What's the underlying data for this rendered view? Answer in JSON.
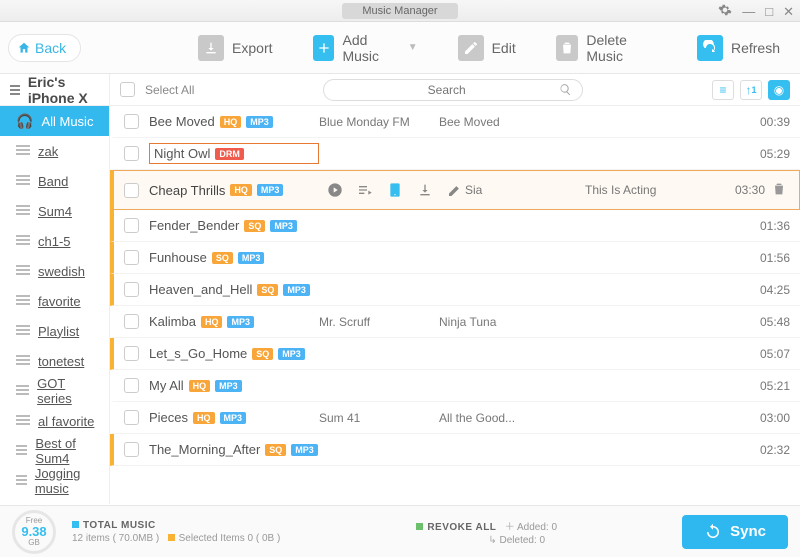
{
  "window": {
    "title": "Music Manager"
  },
  "toolbar": {
    "back": "Back",
    "export": "Export",
    "add_music": "Add Music",
    "edit": "Edit",
    "delete_music": "Delete Music",
    "refresh": "Refresh"
  },
  "sidebar": {
    "device": "Eric's iPhone X",
    "items": [
      {
        "label": "All Music",
        "type": "all",
        "active": true
      },
      {
        "label": "zak",
        "type": "pl"
      },
      {
        "label": "Band",
        "type": "pl"
      },
      {
        "label": "Sum4",
        "type": "pl"
      },
      {
        "label": "ch1-5",
        "type": "pl"
      },
      {
        "label": "swedish",
        "type": "pl"
      },
      {
        "label": "favorite",
        "type": "pl"
      },
      {
        "label": "Playlist",
        "type": "pl"
      },
      {
        "label": "tonetest",
        "type": "pl"
      },
      {
        "label": "GOT series",
        "type": "pl"
      },
      {
        "label": "al favorite",
        "type": "pl"
      },
      {
        "label": "Best of Sum4",
        "type": "pl"
      },
      {
        "label": "Jogging music",
        "type": "pl"
      }
    ]
  },
  "list_header": {
    "select_all": "Select All",
    "search_placeholder": "Search"
  },
  "tracks": [
    {
      "name": "Bee Moved",
      "q": "HQ",
      "fmt": "MP3",
      "artist": "Blue Monday FM",
      "album": "Bee Moved",
      "dur": "00:39",
      "yellow": false
    },
    {
      "name": "Night Owl",
      "drm": true,
      "artist": "",
      "album": "",
      "dur": "05:29",
      "yellow": false
    },
    {
      "name": "Cheap Thrills",
      "q": "HQ",
      "fmt": "MP3",
      "artist": "Sia",
      "album": "This Is Acting",
      "dur": "03:30",
      "yellow": true,
      "selected": true
    },
    {
      "name": "Fender_Bender",
      "q": "SQ",
      "fmt": "MP3",
      "artist": "",
      "album": "",
      "dur": "01:36",
      "yellow": true
    },
    {
      "name": "Funhouse",
      "q": "SQ",
      "fmt": "MP3",
      "artist": "",
      "album": "",
      "dur": "01:56",
      "yellow": true
    },
    {
      "name": "Heaven_and_Hell",
      "q": "SQ",
      "fmt": "MP3",
      "artist": "",
      "album": "",
      "dur": "04:25",
      "yellow": true
    },
    {
      "name": "Kalimba",
      "q": "HQ",
      "fmt": "MP3",
      "artist": "Mr. Scruff",
      "album": "Ninja Tuna",
      "dur": "05:48",
      "yellow": false
    },
    {
      "name": "Let_s_Go_Home",
      "q": "SQ",
      "fmt": "MP3",
      "artist": "",
      "album": "",
      "dur": "05:07",
      "yellow": true
    },
    {
      "name": "My All",
      "q": "HQ",
      "fmt": "MP3",
      "artist": "",
      "album": "",
      "dur": "05:21",
      "yellow": false
    },
    {
      "name": "Pieces",
      "q": "HQ",
      "fmt": "MP3",
      "artist": "Sum 41",
      "album": "All the Good...",
      "dur": "03:00",
      "yellow": false
    },
    {
      "name": "The_Morning_After",
      "q": "SQ",
      "fmt": "MP3",
      "artist": "",
      "album": "",
      "dur": "02:32",
      "yellow": true
    }
  ],
  "footer": {
    "free_label": "Free",
    "free_value": "9.38",
    "free_unit": "GB",
    "total_music_label": "TOTAL MUSIC",
    "total_music_detail": "12 items ( 70.0MB )",
    "selected_detail": "Selected Items 0 ( 0B )",
    "revoke_label": "REVOKE ALL",
    "added": "Added: 0",
    "deleted": "Deleted: 0",
    "sync": "Sync"
  }
}
